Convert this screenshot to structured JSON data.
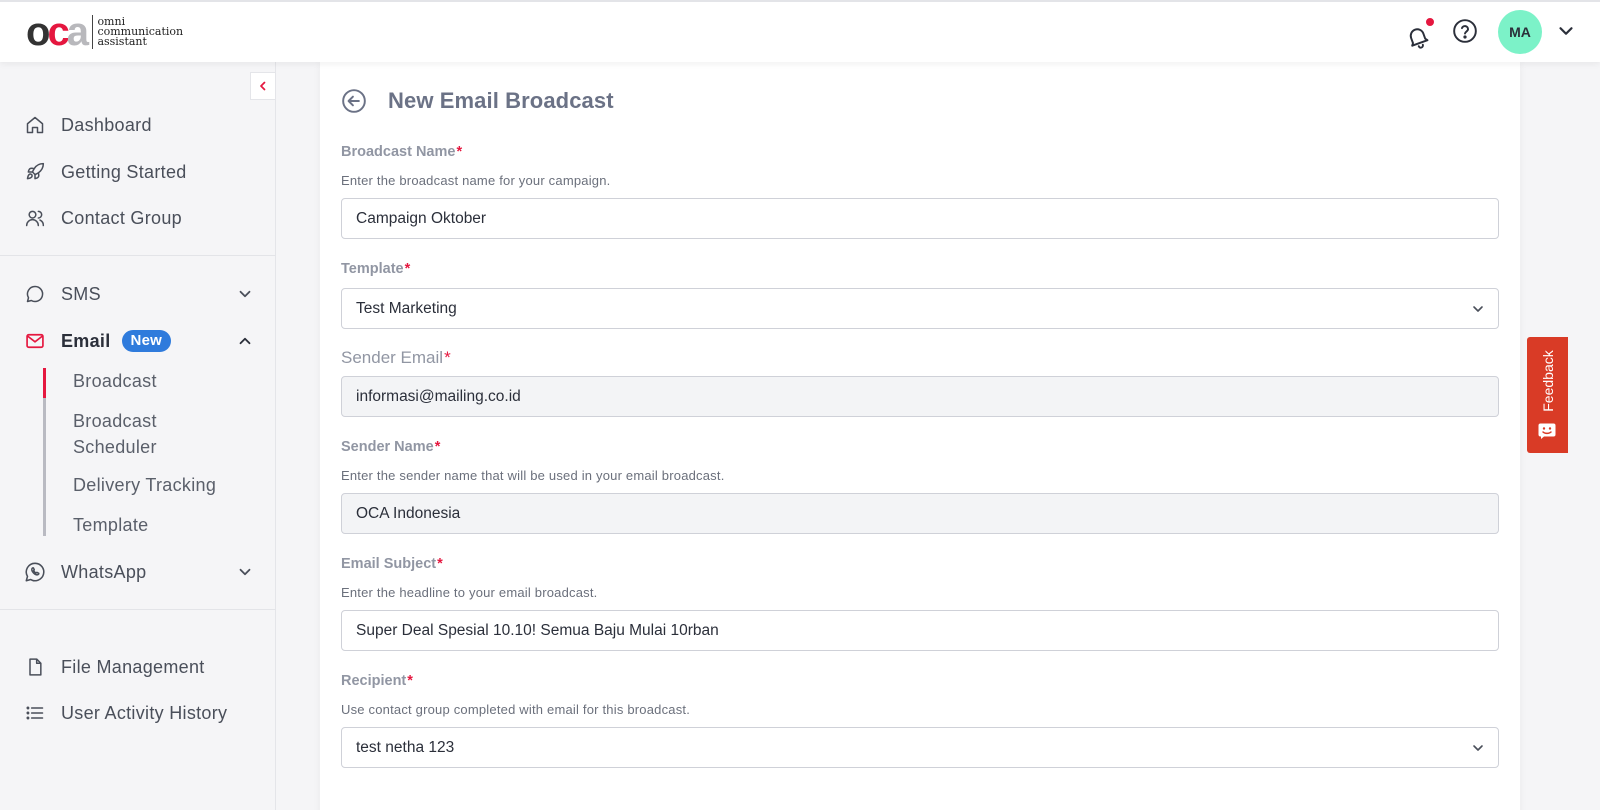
{
  "header": {
    "logo_text_line1": "omni",
    "logo_text_line2": "communication",
    "logo_text_line3": "assistant",
    "logo_letters": [
      "o",
      "c",
      "a"
    ],
    "avatar_initials": "MA",
    "icons": [
      "bell-icon",
      "help-icon",
      "chevron-down-icon"
    ]
  },
  "sidebar": {
    "items": [
      {
        "label": "Dashboard",
        "icon": "home-icon"
      },
      {
        "label": "Getting Started",
        "icon": "rocket-icon"
      },
      {
        "label": "Contact Group",
        "icon": "users-icon"
      },
      {
        "label": "SMS",
        "icon": "chat-icon"
      },
      {
        "label": "Email",
        "icon": "mail-icon",
        "badge": "New"
      },
      {
        "label": "WhatsApp",
        "icon": "whatsapp-icon"
      },
      {
        "label": "File Management",
        "icon": "file-icon"
      },
      {
        "label": "User Activity History",
        "icon": "list-icon"
      }
    ],
    "email_subitems": [
      {
        "label": "Broadcast",
        "active": true
      },
      {
        "label": "Broadcast Scheduler",
        "active": false
      },
      {
        "label": "Delivery Tracking",
        "active": false
      },
      {
        "label": "Template",
        "active": false
      }
    ]
  },
  "main": {
    "title": "New Email Broadcast",
    "fields": {
      "broadcast_name": {
        "label": "Broadcast Name",
        "required": "*",
        "help": "Enter the broadcast name for your campaign.",
        "value": "Campaign Oktober"
      },
      "template": {
        "label": "Template",
        "required": "*",
        "value": "Test Marketing"
      },
      "sender_email": {
        "label": "Sender Email",
        "required": "*",
        "value": "informasi@mailing.co.id"
      },
      "sender_name": {
        "label": "Sender Name",
        "required": "*",
        "help": "Enter the sender name that will be used in your email broadcast.",
        "value": "OCA Indonesia"
      },
      "email_subject": {
        "label": "Email Subject",
        "required": "*",
        "help": "Enter the headline to your email broadcast.",
        "value": "Super Deal Spesial 10.10! Semua Baju Mulai 10rban"
      },
      "recipient": {
        "label": "Recipient",
        "required": "*",
        "help": "Use contact group completed with email for this broadcast.",
        "value": "test netha 123"
      }
    }
  },
  "feedback": {
    "label": "Feedback"
  },
  "colors": {
    "brand_red": "#e5173f",
    "badge_blue": "#2f7bdc",
    "avatar_mint": "#7cf2c8",
    "feedback_red": "#d93b26"
  }
}
